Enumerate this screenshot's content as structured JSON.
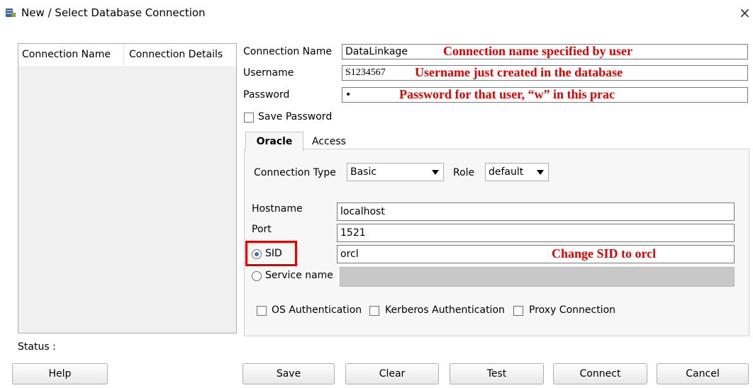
{
  "window": {
    "title": "New / Select Database Connection",
    "close_glyph": "×",
    "icon": "database-icon"
  },
  "connections_list": {
    "columns": [
      "Connection Name",
      "Connection Details"
    ]
  },
  "form": {
    "connection_name_label": "Connection Name",
    "connection_name_value": "DataLinkage",
    "username_label": "Username",
    "username_value": "S1234567",
    "password_label": "Password",
    "password_value": "•",
    "save_password_label": "Save Password",
    "save_password_checked": false
  },
  "annotations": {
    "connection_name": "Connection name specified by user",
    "username": "Username just created in the database",
    "password": "Password for that user, “w” in this prac",
    "sid": "Change SID to orcl",
    "color": "#e00000"
  },
  "tabs": [
    {
      "label": "Oracle",
      "active": true
    },
    {
      "label": "Access",
      "active": false
    }
  ],
  "oracle": {
    "connection_type_label": "Connection Type",
    "connection_type_value": "Basic",
    "role_label": "Role",
    "role_value": "default",
    "hostname_label": "Hostname",
    "hostname_value": "localhost",
    "port_label": "Port",
    "port_value": "1521",
    "sid_label": "SID",
    "sid_value": "orcl",
    "sid_selected": true,
    "service_name_label": "Service name",
    "service_name_value": "",
    "os_auth_label": "OS Authentication",
    "kerberos_auth_label": "Kerberos Authentication",
    "proxy_conn_label": "Proxy Connection"
  },
  "status": {
    "label": "Status :"
  },
  "buttons": {
    "help": "Help",
    "save": "Save",
    "clear": "Clear",
    "test": "Test",
    "connect": "Connect",
    "cancel": "Cancel"
  }
}
